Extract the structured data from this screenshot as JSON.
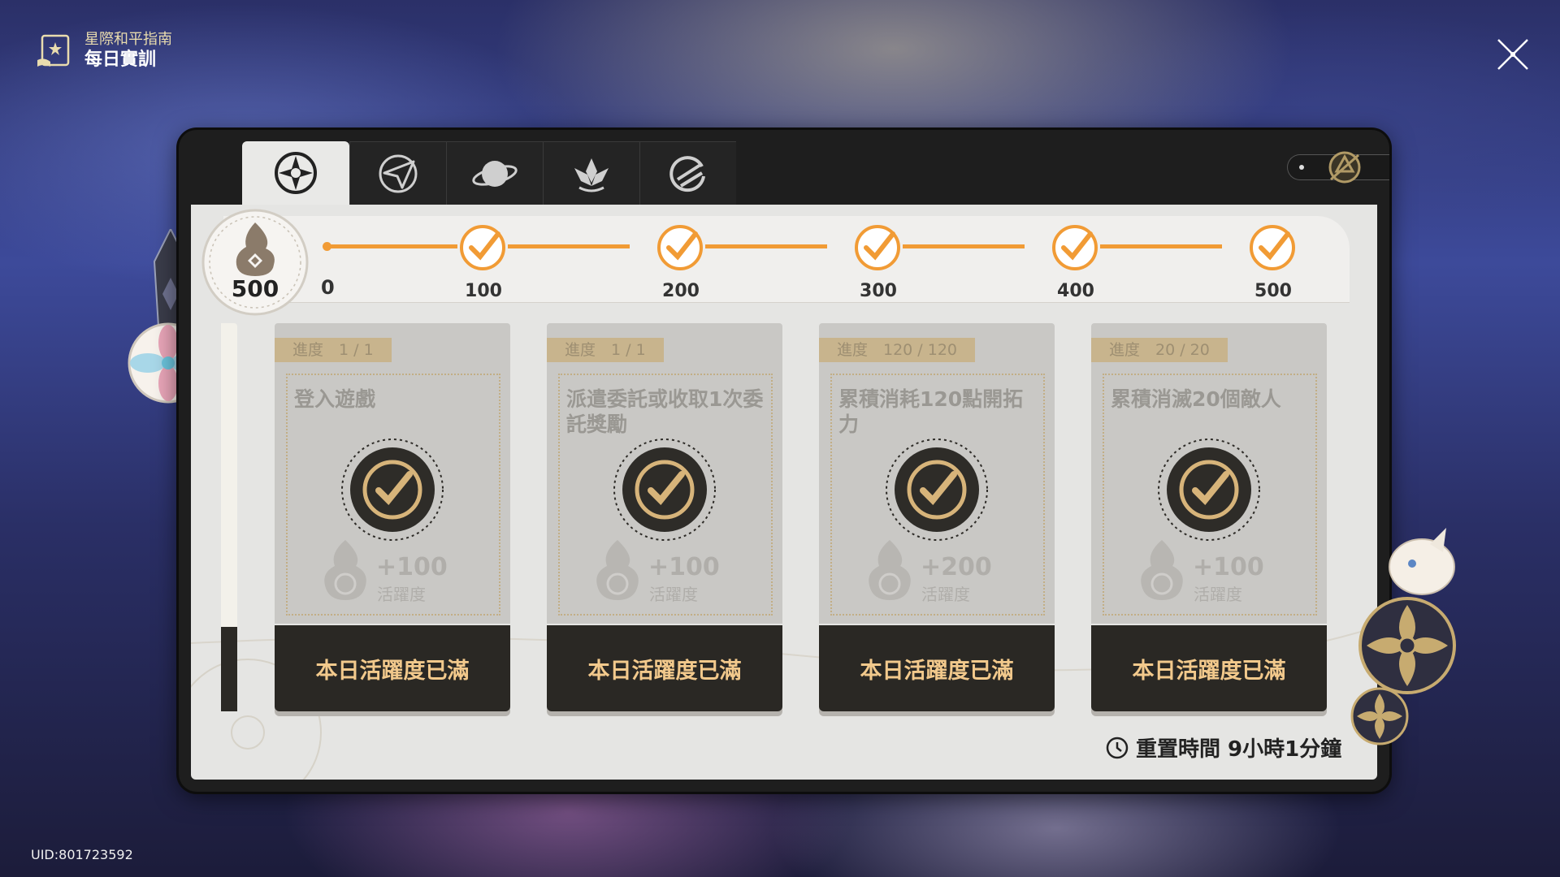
{
  "header": {
    "subtitle": "星際和平指南",
    "title": "每日實訓"
  },
  "tabs": [
    {
      "icon": "daily-training-icon",
      "active": true
    },
    {
      "icon": "paper-plane-icon",
      "active": false
    },
    {
      "icon": "planet-icon",
      "active": false
    },
    {
      "icon": "lotus-icon",
      "active": false
    },
    {
      "icon": "cycle-icon",
      "active": false
    }
  ],
  "activity": {
    "current": "500",
    "start_label": "0",
    "milestones": [
      "100",
      "200",
      "300",
      "400",
      "500"
    ]
  },
  "tasks": [
    {
      "progress": "進度　1 / 1",
      "title": "登入遊戲",
      "reward": "+100",
      "reward_unit": "活躍度",
      "button": "本日活躍度已滿"
    },
    {
      "progress": "進度　1 / 1",
      "title": "派遣委託或收取1次委託獎勵",
      "reward": "+100",
      "reward_unit": "活躍度",
      "button": "本日活躍度已滿"
    },
    {
      "progress": "進度　120 / 120",
      "title": "累積消耗120點開拓力",
      "reward": "+200",
      "reward_unit": "活躍度",
      "button": "本日活躍度已滿"
    },
    {
      "progress": "進度　20 / 20",
      "title": "累積消滅20個敵人",
      "reward": "+100",
      "reward_unit": "活躍度",
      "button": "本日活躍度已滿"
    }
  ],
  "reset": "重置時間 9小時1分鐘",
  "uid": "UID:801723592",
  "colors": {
    "accent": "#f19b35",
    "button_text": "#f2c98c",
    "panel": "#1e1e1e"
  }
}
